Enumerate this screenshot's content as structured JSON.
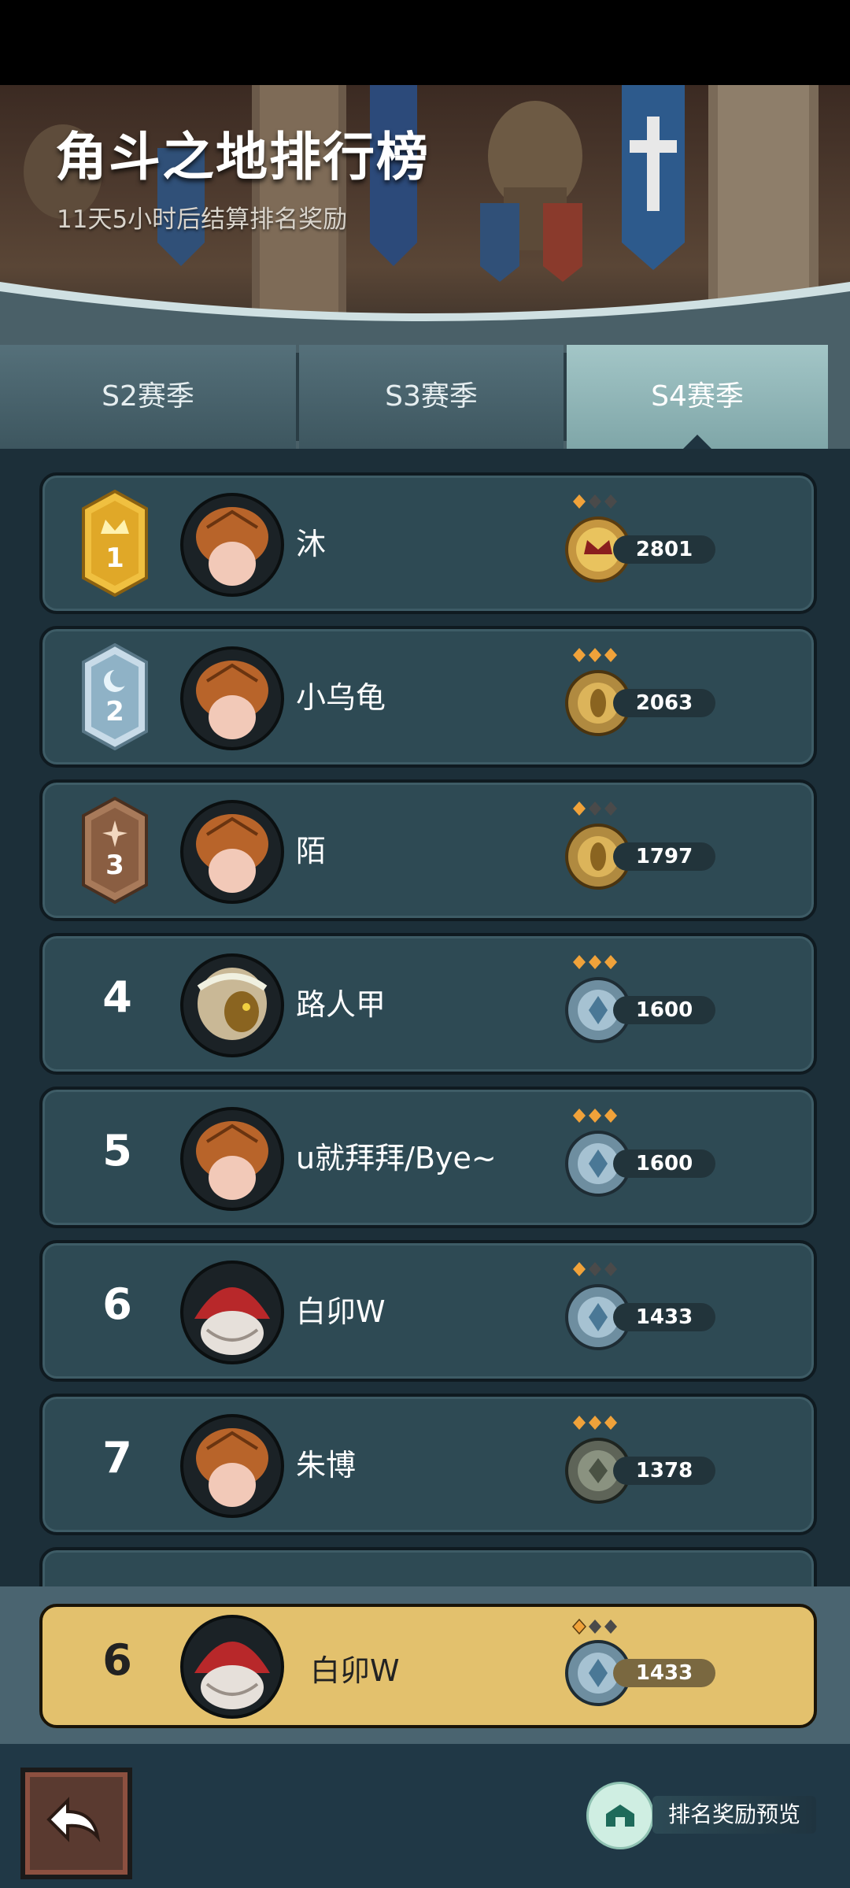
{
  "header": {
    "title": "角斗之地排行榜",
    "subtitle": "11天5小时后结算排名奖励"
  },
  "tabs": [
    {
      "label": "S2赛季",
      "active": false
    },
    {
      "label": "S3赛季",
      "active": false
    },
    {
      "label": "S4赛季",
      "active": true
    }
  ],
  "ranking": [
    {
      "rank": "1",
      "name": "沐",
      "score": "2801",
      "stars": 1,
      "tier": "gold-crown"
    },
    {
      "rank": "2",
      "name": "小乌龟",
      "score": "2063",
      "stars": 3,
      "tier": "gold"
    },
    {
      "rank": "3",
      "name": "陌",
      "score": "1797",
      "stars": 1,
      "tier": "gold"
    },
    {
      "rank": "4",
      "name": "路人甲",
      "score": "1600",
      "stars": 3,
      "tier": "silver"
    },
    {
      "rank": "5",
      "name": "u就拜拜/Bye~",
      "score": "1600",
      "stars": 3,
      "tier": "silver"
    },
    {
      "rank": "6",
      "name": "白卯W",
      "score": "1433",
      "stars": 1,
      "tier": "silver"
    },
    {
      "rank": "7",
      "name": "朱博",
      "score": "1378",
      "stars": 3,
      "tier": "bronze"
    }
  ],
  "my_rank": {
    "rank": "6",
    "name": "白卯W",
    "score": "1433",
    "stars": 1
  },
  "footer": {
    "reward_preview_label": "排名奖励预览"
  },
  "colors": {
    "row_bg": "#2e4a54",
    "my_row_bg": "#e3c16d",
    "diamond_on": "#f0a23a",
    "diamond_off": "#4a4a4a"
  }
}
